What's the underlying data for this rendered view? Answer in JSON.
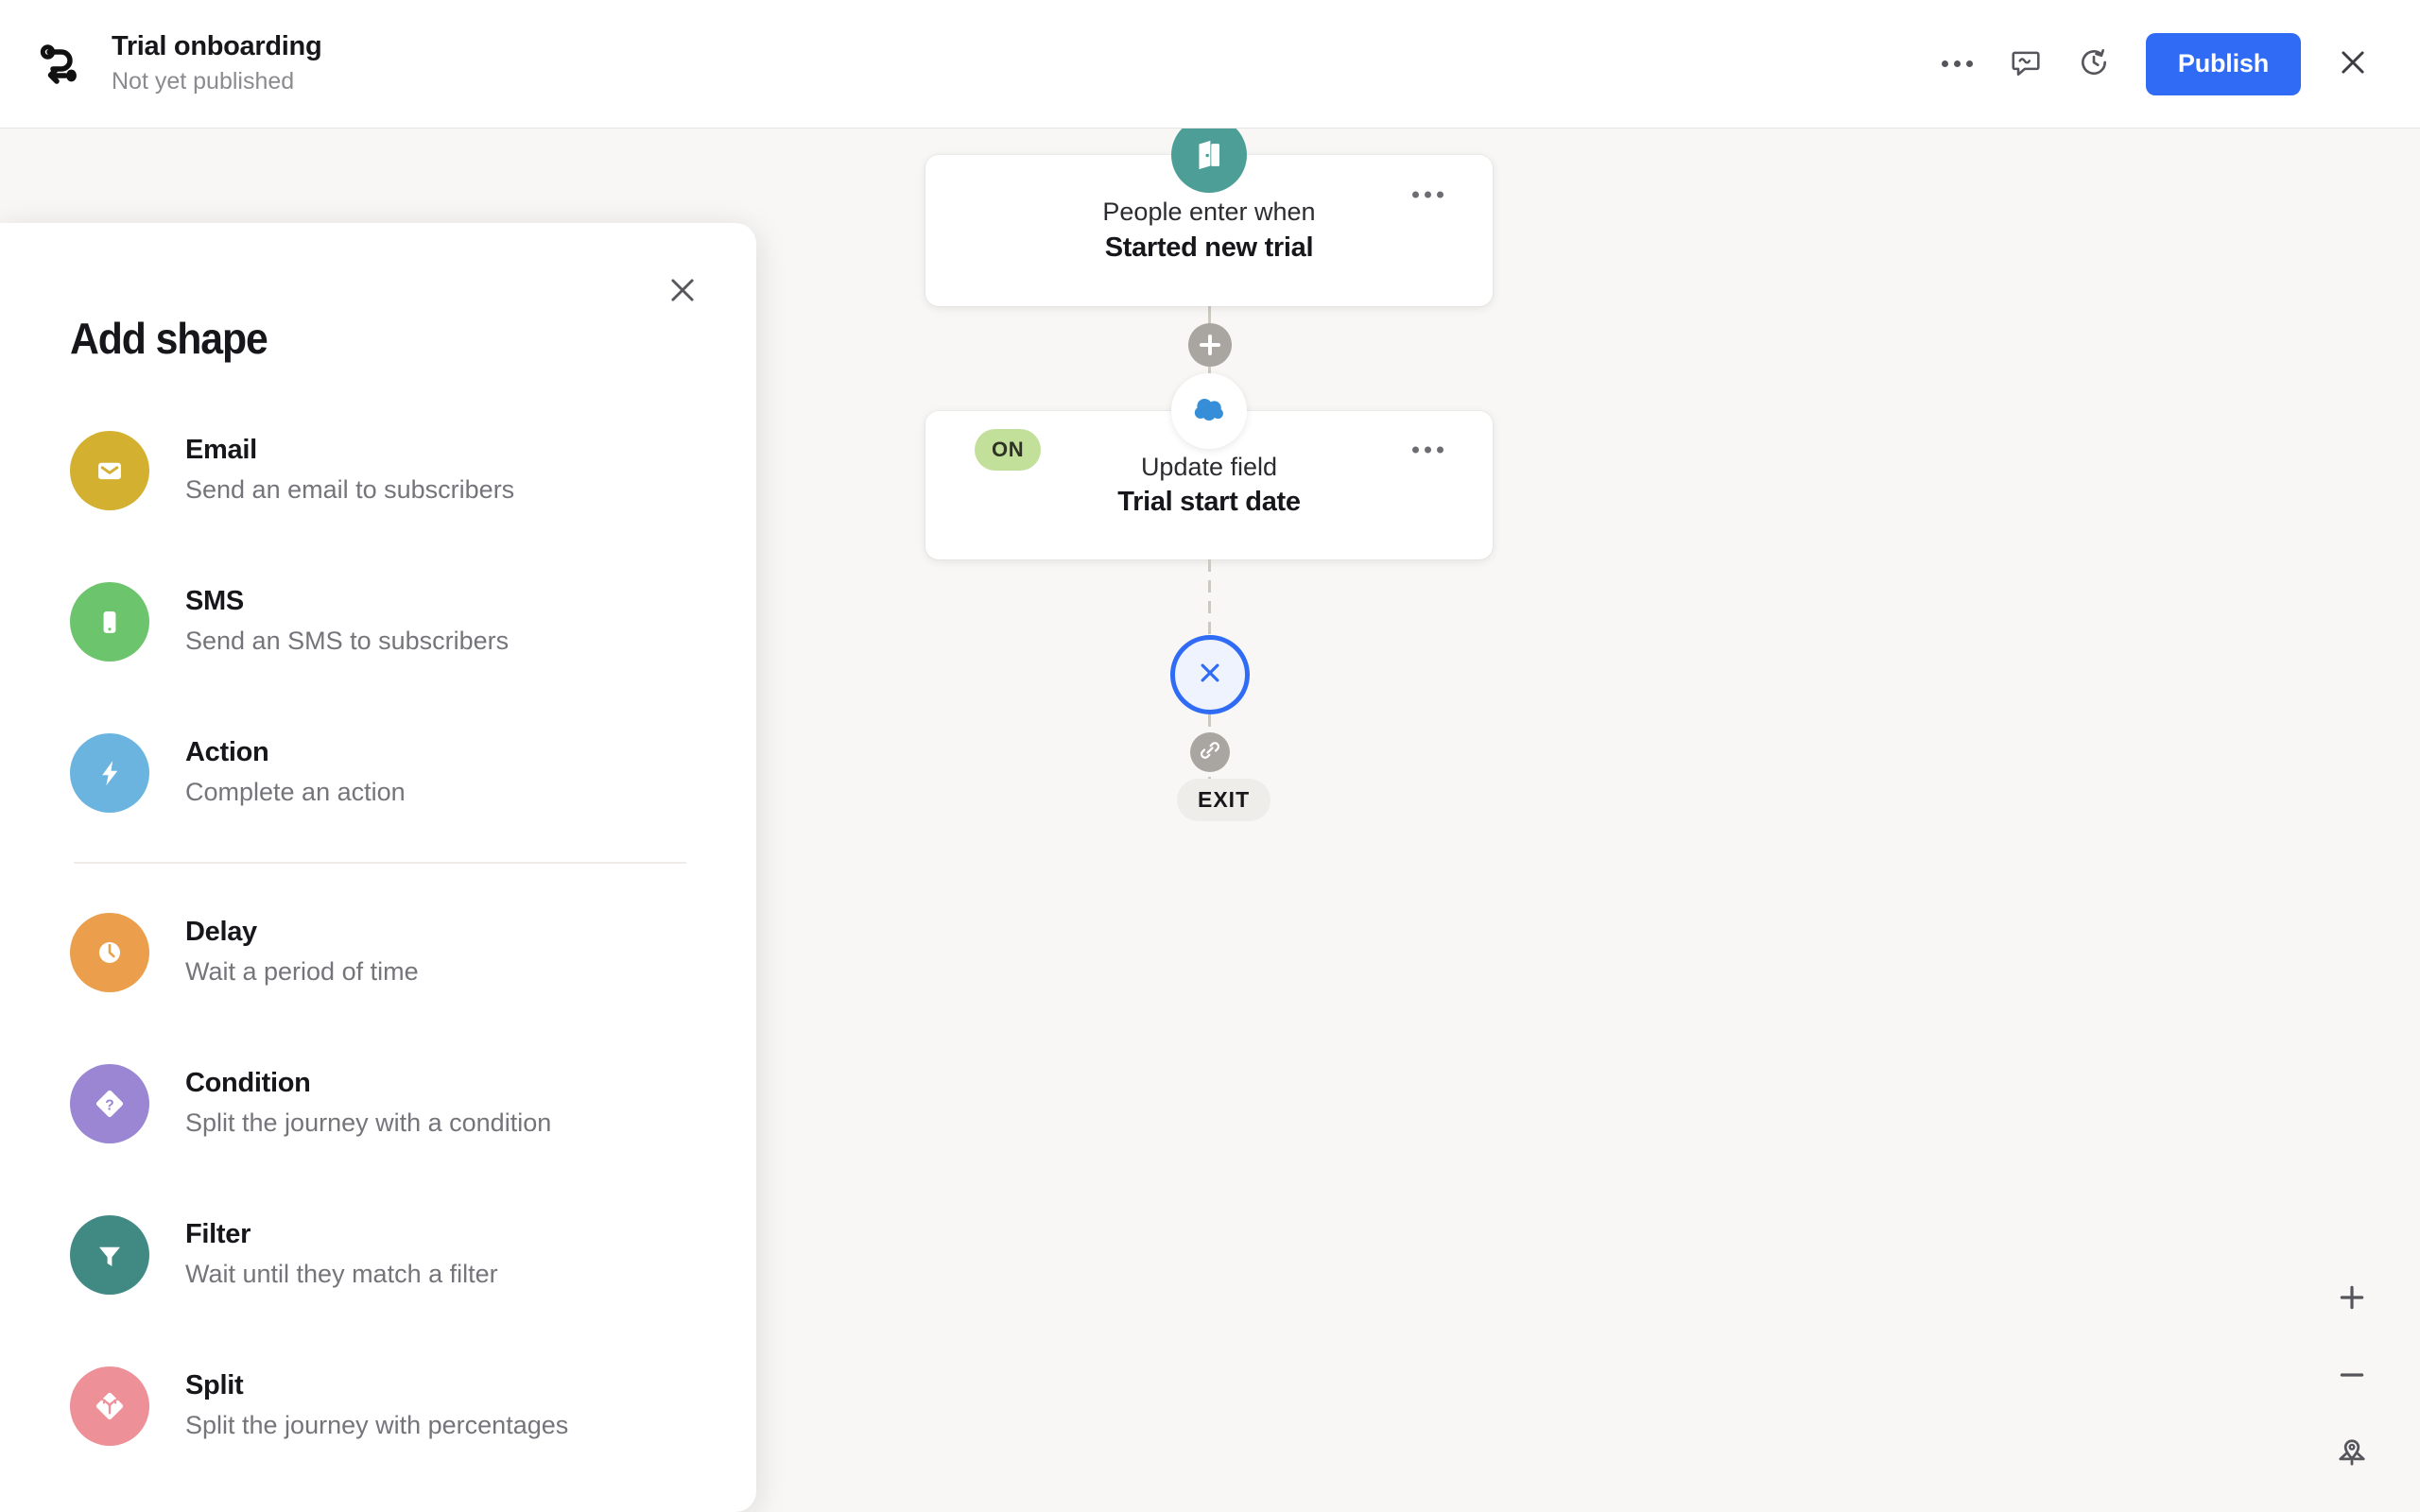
{
  "topbar": {
    "journey_icon": "journey-path-icon",
    "title": "Trial onboarding",
    "subtitle": "Not yet published",
    "more_icon": "ellipsis-icon",
    "comment_icon": "comment-icon",
    "history_icon": "version-history-icon",
    "publish_label": "Publish",
    "close_icon": "close-icon"
  },
  "panel": {
    "title": "Add shape",
    "close_icon": "close-icon",
    "items": [
      {
        "name": "Email",
        "desc": "Send an email to subscribers",
        "icon": "envelope-icon",
        "color": "#d3b02f"
      },
      {
        "name": "SMS",
        "desc": "Send an SMS to subscribers",
        "icon": "mobile-icon",
        "color": "#6cc46c"
      },
      {
        "name": "Action",
        "desc": "Complete an action",
        "icon": "bolt-icon",
        "color": "#6cb4e0"
      },
      {
        "name": "Delay",
        "desc": "Wait a period of time",
        "icon": "clock-icon",
        "color": "#eb9f4c"
      },
      {
        "name": "Condition",
        "desc": "Split the journey with a condition",
        "icon": "question-diamond-icon",
        "color": "#9b86d4"
      },
      {
        "name": "Filter",
        "desc": "Wait until they match a filter",
        "icon": "funnel-icon",
        "color": "#418a84"
      },
      {
        "name": "Split",
        "desc": "Split the journey with percentages",
        "icon": "fork-diamond-icon",
        "color": "#ee9098"
      }
    ],
    "divider_after_index": 2
  },
  "canvas": {
    "background": "#f8f7f5",
    "nodes": [
      {
        "icon": "door-open-icon",
        "icon_color": "#4d9e96",
        "line1": "People enter when",
        "line2": "Started new trial",
        "menu_icon": "ellipsis-icon",
        "badge": null
      },
      {
        "icon": "salesforce-cloud-icon",
        "icon_color": "#2f8fd8",
        "line1": "Update field",
        "line2": "Trial start date",
        "menu_icon": "ellipsis-icon",
        "badge": "ON"
      }
    ],
    "add_step_icon": "plus-icon",
    "link_icon": "link-icon",
    "terminal_icon": "close-icon",
    "terminal_color": "#2f6bf5",
    "exit_label": "EXIT"
  },
  "zoom_controls": {
    "zoom_in_icon": "plus-icon",
    "zoom_out_icon": "minus-icon",
    "fit_view_icon": "location-pin-icon"
  },
  "colors": {
    "accent": "#2f6bf5",
    "canvas_bg": "#f8f7f5",
    "badge_on_bg": "#c3e09a",
    "connector": "#cdc9c2"
  }
}
